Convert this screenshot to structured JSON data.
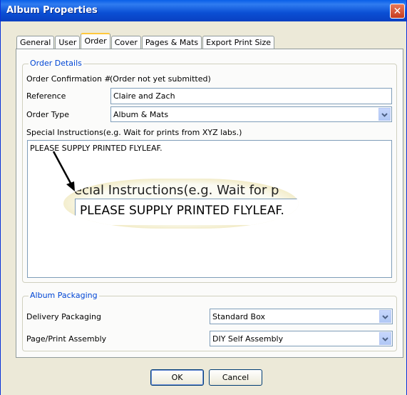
{
  "window": {
    "title": "Album Properties",
    "close_glyph": "✕"
  },
  "tabs": [
    {
      "label": "General"
    },
    {
      "label": "User"
    },
    {
      "label": "Order"
    },
    {
      "label": "Cover"
    },
    {
      "label": "Pages & Mats"
    },
    {
      "label": "Export Print Size"
    }
  ],
  "order_details": {
    "legend": "Order Details",
    "confirmation_label": "Order Confirmation #",
    "confirmation_value": "(Order not yet submitted)",
    "reference_label": "Reference",
    "reference_value": "Claire and Zach",
    "order_type_label": "Order Type",
    "order_type_value": "Album & Mats",
    "instructions_label": "Special Instructions(e.g. Wait for prints from XYZ labs.)",
    "instructions_value": "PLEASE SUPPLY PRINTED FLYLEAF."
  },
  "magnifier": {
    "label_text": "ecial Instructions(e.g. Wait for p",
    "value_text": "PLEASE SUPPLY PRINTED FLYLEAF."
  },
  "album_packaging": {
    "legend": "Album Packaging",
    "delivery_label": "Delivery Packaging",
    "delivery_value": "Standard Box",
    "assembly_label": "Page/Print Assembly",
    "assembly_value": "DIY Self Assembly"
  },
  "buttons": {
    "ok": "OK",
    "cancel": "Cancel"
  },
  "icons": {
    "dropdown": "chevron-down-icon",
    "close": "close-icon",
    "annotation": "arrow-icon"
  }
}
